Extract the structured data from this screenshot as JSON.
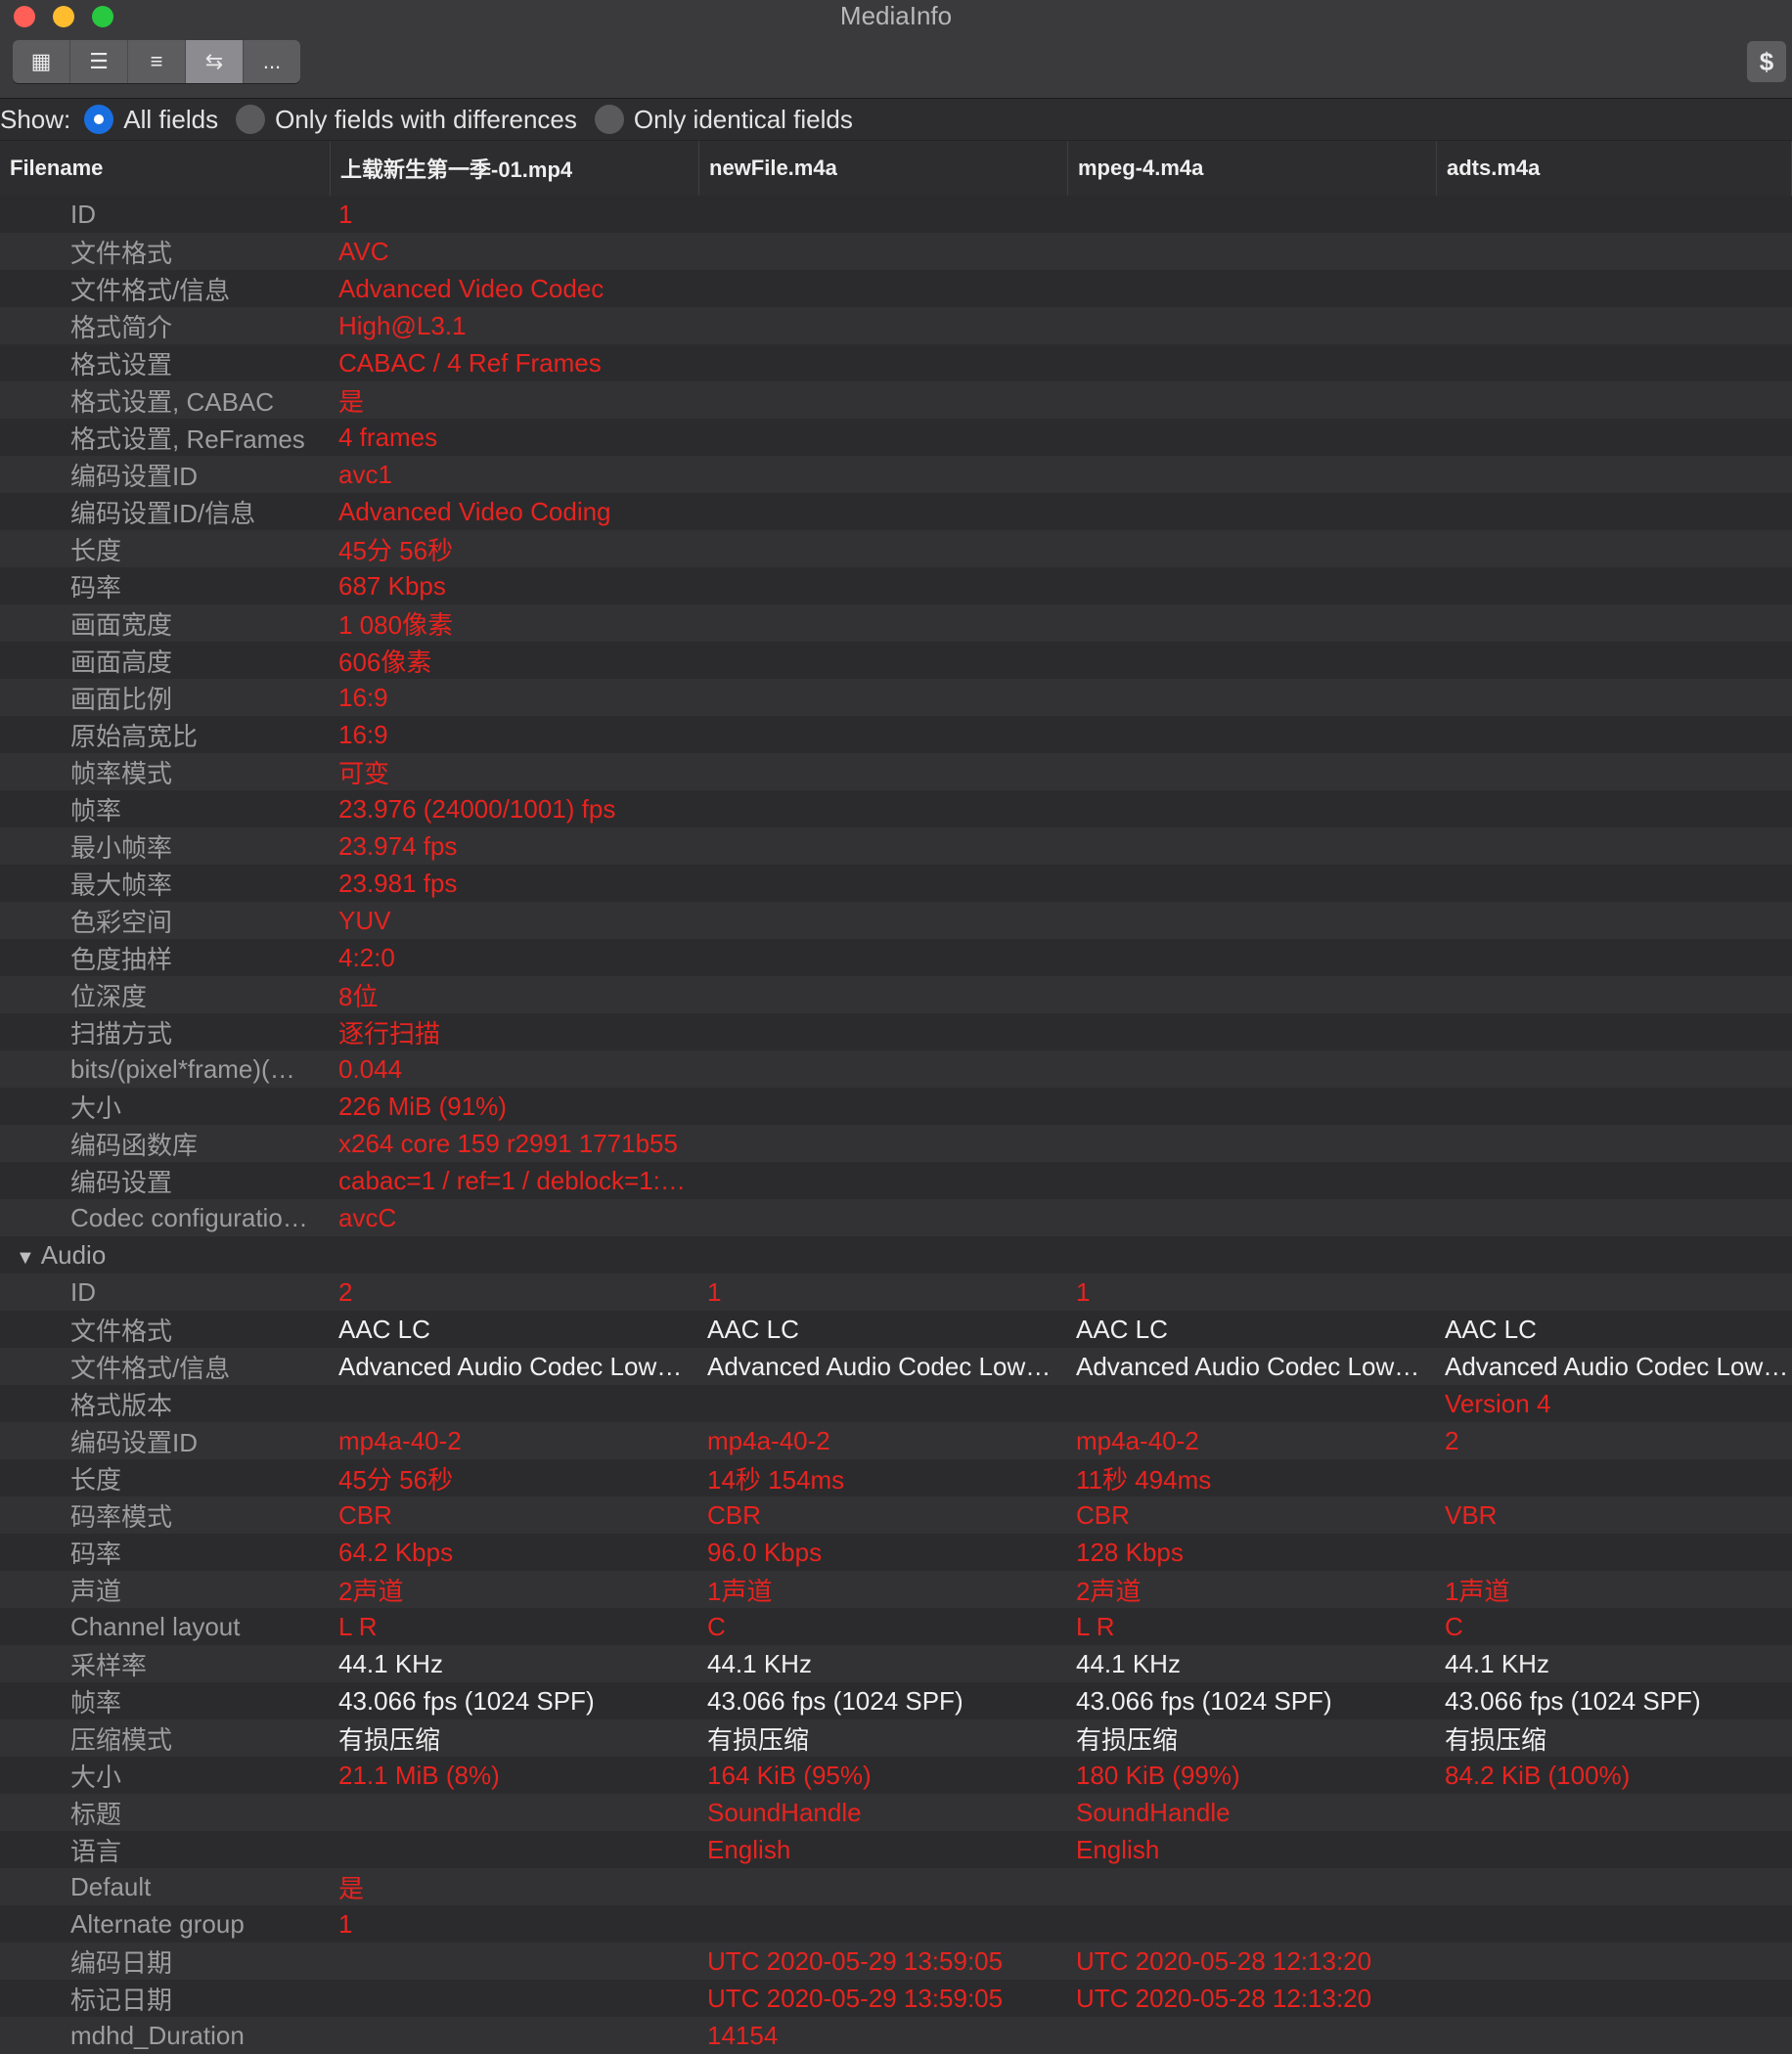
{
  "window": {
    "title": "MediaInfo"
  },
  "toolbar": {
    "view_buttons": [
      "▦",
      "☰",
      "≡",
      "⇆",
      "..."
    ],
    "donate_label": "$"
  },
  "show": {
    "label": "Show:",
    "options": [
      "All fields",
      "Only fields with differences",
      "Only identical fields"
    ],
    "selected": "All fields"
  },
  "columns": [
    "Filename",
    "上载新生第一季-01.mp4",
    "newFile.m4a",
    "mpeg-4.m4a",
    "adts.m4a"
  ],
  "rows": [
    {
      "name": "ID",
      "v": [
        "1",
        "",
        "",
        ""
      ],
      "c": [
        "r",
        "",
        "",
        ""
      ]
    },
    {
      "name": "文件格式",
      "v": [
        "AVC",
        "",
        "",
        ""
      ],
      "c": [
        "r",
        "",
        "",
        ""
      ]
    },
    {
      "name": "文件格式/信息",
      "v": [
        "Advanced Video Codec",
        "",
        "",
        ""
      ],
      "c": [
        "r",
        "",
        "",
        ""
      ]
    },
    {
      "name": "格式简介",
      "v": [
        "High@L3.1",
        "",
        "",
        ""
      ],
      "c": [
        "r",
        "",
        "",
        ""
      ]
    },
    {
      "name": "格式设置",
      "v": [
        "CABAC / 4 Ref Frames",
        "",
        "",
        ""
      ],
      "c": [
        "r",
        "",
        "",
        ""
      ]
    },
    {
      "name": "格式设置, CABAC",
      "v": [
        "是",
        "",
        "",
        ""
      ],
      "c": [
        "r",
        "",
        "",
        ""
      ]
    },
    {
      "name": "格式设置, ReFrames",
      "v": [
        "4 frames",
        "",
        "",
        ""
      ],
      "c": [
        "r",
        "",
        "",
        ""
      ]
    },
    {
      "name": "编码设置ID",
      "v": [
        "avc1",
        "",
        "",
        ""
      ],
      "c": [
        "r",
        "",
        "",
        ""
      ]
    },
    {
      "name": "编码设置ID/信息",
      "v": [
        "Advanced Video Coding",
        "",
        "",
        ""
      ],
      "c": [
        "r",
        "",
        "",
        ""
      ]
    },
    {
      "name": "长度",
      "v": [
        "45分 56秒",
        "",
        "",
        ""
      ],
      "c": [
        "r",
        "",
        "",
        ""
      ]
    },
    {
      "name": "码率",
      "v": [
        "687 Kbps",
        "",
        "",
        ""
      ],
      "c": [
        "r",
        "",
        "",
        ""
      ]
    },
    {
      "name": "画面宽度",
      "v": [
        "1 080像素",
        "",
        "",
        ""
      ],
      "c": [
        "r",
        "",
        "",
        ""
      ]
    },
    {
      "name": "画面高度",
      "v": [
        "606像素",
        "",
        "",
        ""
      ],
      "c": [
        "r",
        "",
        "",
        ""
      ]
    },
    {
      "name": "画面比例",
      "v": [
        "16:9",
        "",
        "",
        ""
      ],
      "c": [
        "r",
        "",
        "",
        ""
      ]
    },
    {
      "name": "原始高宽比",
      "v": [
        "16:9",
        "",
        "",
        ""
      ],
      "c": [
        "r",
        "",
        "",
        ""
      ]
    },
    {
      "name": "帧率模式",
      "v": [
        "可变",
        "",
        "",
        ""
      ],
      "c": [
        "r",
        "",
        "",
        ""
      ]
    },
    {
      "name": "帧率",
      "v": [
        "23.976 (24000/1001) fps",
        "",
        "",
        ""
      ],
      "c": [
        "r",
        "",
        "",
        ""
      ]
    },
    {
      "name": "最小帧率",
      "v": [
        "23.974 fps",
        "",
        "",
        ""
      ],
      "c": [
        "r",
        "",
        "",
        ""
      ]
    },
    {
      "name": "最大帧率",
      "v": [
        "23.981 fps",
        "",
        "",
        ""
      ],
      "c": [
        "r",
        "",
        "",
        ""
      ]
    },
    {
      "name": "色彩空间",
      "v": [
        "YUV",
        "",
        "",
        ""
      ],
      "c": [
        "r",
        "",
        "",
        ""
      ]
    },
    {
      "name": "色度抽样",
      "v": [
        "4:2:0",
        "",
        "",
        ""
      ],
      "c": [
        "r",
        "",
        "",
        ""
      ]
    },
    {
      "name": "位深度",
      "v": [
        "8位",
        "",
        "",
        ""
      ],
      "c": [
        "r",
        "",
        "",
        ""
      ]
    },
    {
      "name": "扫描方式",
      "v": [
        "逐行扫描",
        "",
        "",
        ""
      ],
      "c": [
        "r",
        "",
        "",
        ""
      ]
    },
    {
      "name": "bits/(pixel*frame)(…",
      "v": [
        "0.044",
        "",
        "",
        ""
      ],
      "c": [
        "r",
        "",
        "",
        ""
      ]
    },
    {
      "name": "大小",
      "v": [
        "226 MiB (91%)",
        "",
        "",
        ""
      ],
      "c": [
        "r",
        "",
        "",
        ""
      ]
    },
    {
      "name": "编码函数库",
      "v": [
        "x264 core 159 r2991 1771b55",
        "",
        "",
        ""
      ],
      "c": [
        "r",
        "",
        "",
        ""
      ]
    },
    {
      "name": "编码设置",
      "v": [
        "cabac=1 / ref=1 / deblock=1:…",
        "",
        "",
        ""
      ],
      "c": [
        "r",
        "",
        "",
        ""
      ]
    },
    {
      "name": "Codec configuratio…",
      "v": [
        "avcC",
        "",
        "",
        ""
      ],
      "c": [
        "r",
        "",
        "",
        ""
      ]
    },
    {
      "name": "Audio",
      "section": true,
      "v": [
        "",
        "",
        "",
        ""
      ],
      "c": [
        "",
        "",
        "",
        ""
      ]
    },
    {
      "name": "ID",
      "v": [
        "2",
        "1",
        "1",
        ""
      ],
      "c": [
        "r",
        "r",
        "r",
        ""
      ]
    },
    {
      "name": "文件格式",
      "v": [
        "AAC LC",
        "AAC LC",
        "AAC LC",
        "AAC LC"
      ],
      "c": [
        "w",
        "w",
        "w",
        "w"
      ]
    },
    {
      "name": "文件格式/信息",
      "v": [
        "Advanced Audio Codec Low…",
        "Advanced Audio Codec Low…",
        "Advanced Audio Codec Low…",
        "Advanced Audio Codec Low…"
      ],
      "c": [
        "w",
        "w",
        "w",
        "w"
      ]
    },
    {
      "name": "格式版本",
      "v": [
        "",
        "",
        "",
        "Version 4"
      ],
      "c": [
        "",
        "",
        "",
        "r"
      ]
    },
    {
      "name": "编码设置ID",
      "v": [
        "mp4a-40-2",
        "mp4a-40-2",
        "mp4a-40-2",
        "2"
      ],
      "c": [
        "r",
        "r",
        "r",
        "r"
      ]
    },
    {
      "name": "长度",
      "v": [
        "45分 56秒",
        "14秒 154ms",
        "11秒 494ms",
        ""
      ],
      "c": [
        "r",
        "r",
        "r",
        ""
      ]
    },
    {
      "name": "码率模式",
      "v": [
        "CBR",
        "CBR",
        "CBR",
        "VBR"
      ],
      "c": [
        "r",
        "r",
        "r",
        "r"
      ]
    },
    {
      "name": "码率",
      "v": [
        "64.2 Kbps",
        "96.0 Kbps",
        "128 Kbps",
        ""
      ],
      "c": [
        "r",
        "r",
        "r",
        ""
      ]
    },
    {
      "name": "声道",
      "v": [
        "2声道",
        "1声道",
        "2声道",
        "1声道"
      ],
      "c": [
        "r",
        "r",
        "r",
        "r"
      ]
    },
    {
      "name": "Channel layout",
      "v": [
        "L R",
        "C",
        "L R",
        "C"
      ],
      "c": [
        "r",
        "r",
        "r",
        "r"
      ]
    },
    {
      "name": "采样率",
      "v": [
        "44.1 KHz",
        "44.1 KHz",
        "44.1 KHz",
        "44.1 KHz"
      ],
      "c": [
        "w",
        "w",
        "w",
        "w"
      ]
    },
    {
      "name": "帧率",
      "v": [
        "43.066 fps (1024 SPF)",
        "43.066 fps (1024 SPF)",
        "43.066 fps (1024 SPF)",
        "43.066 fps (1024 SPF)"
      ],
      "c": [
        "w",
        "w",
        "w",
        "w"
      ]
    },
    {
      "name": "压缩模式",
      "v": [
        "有损压缩",
        "有损压缩",
        "有损压缩",
        "有损压缩"
      ],
      "c": [
        "w",
        "w",
        "w",
        "w"
      ]
    },
    {
      "name": "大小",
      "v": [
        "21.1 MiB (8%)",
        "164 KiB (95%)",
        "180 KiB (99%)",
        "84.2 KiB (100%)"
      ],
      "c": [
        "r",
        "r",
        "r",
        "r"
      ]
    },
    {
      "name": "标题",
      "v": [
        "",
        "SoundHandle",
        "SoundHandle",
        ""
      ],
      "c": [
        "",
        "r",
        "r",
        ""
      ]
    },
    {
      "name": "语言",
      "v": [
        "",
        "English",
        "English",
        ""
      ],
      "c": [
        "",
        "r",
        "r",
        ""
      ]
    },
    {
      "name": "Default",
      "v": [
        "是",
        "",
        "",
        ""
      ],
      "c": [
        "r",
        "",
        "",
        ""
      ]
    },
    {
      "name": "Alternate group",
      "v": [
        "1",
        "",
        "",
        ""
      ],
      "c": [
        "r",
        "",
        "",
        ""
      ]
    },
    {
      "name": "编码日期",
      "v": [
        "",
        "UTC 2020-05-29 13:59:05",
        "UTC 2020-05-28 12:13:20",
        ""
      ],
      "c": [
        "",
        "r",
        "r",
        ""
      ]
    },
    {
      "name": "标记日期",
      "v": [
        "",
        "UTC 2020-05-29 13:59:05",
        "UTC 2020-05-28 12:13:20",
        ""
      ],
      "c": [
        "",
        "r",
        "r",
        ""
      ]
    },
    {
      "name": "mdhd_Duration",
      "v": [
        "",
        "14154",
        "",
        ""
      ],
      "c": [
        "",
        "r",
        "",
        ""
      ]
    }
  ],
  "colors": {
    "diff": "#e8231f",
    "same": "#f0f0f0",
    "label": "#9d9d9f"
  }
}
